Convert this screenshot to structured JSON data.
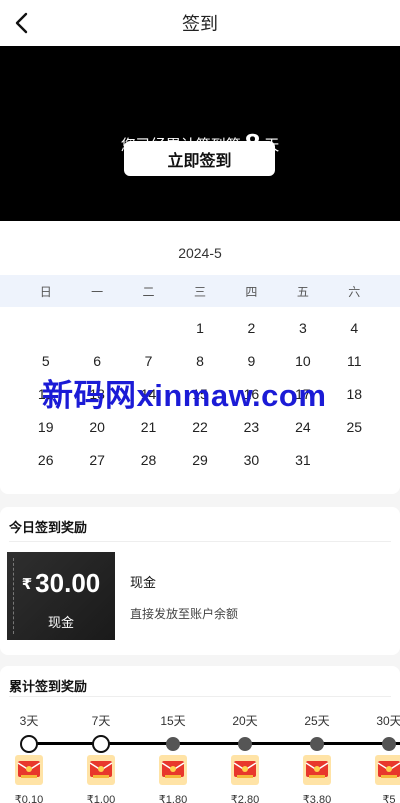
{
  "header": {
    "title": "签到"
  },
  "hero": {
    "prefix": "您已经累计签到第",
    "days": "8",
    "suffix": "天",
    "button_label": "立即签到"
  },
  "calendar": {
    "month": "2024-5",
    "weekdays": [
      "日",
      "一",
      "二",
      "三",
      "四",
      "五",
      "六"
    ],
    "leading_blanks": 3,
    "days": [
      "1",
      "2",
      "3",
      "4",
      "5",
      "6",
      "7",
      "8",
      "9",
      "10",
      "11",
      "12",
      "13",
      "14",
      "15",
      "16",
      "17",
      "18",
      "19",
      "20",
      "21",
      "22",
      "23",
      "24",
      "25",
      "26",
      "27",
      "28",
      "29",
      "30",
      "31"
    ]
  },
  "watermark": "新码网xinmaw.com",
  "today_reward": {
    "title": "今日签到奖励",
    "currency": "₹",
    "amount": "30.00",
    "unit": "现金",
    "name": "现金",
    "desc": "直接发放至账户余额"
  },
  "cumulative": {
    "title": "累计签到奖励",
    "milestones": [
      {
        "label": "3天",
        "status": "done",
        "amount": "₹0.10"
      },
      {
        "label": "7天",
        "status": "done",
        "amount": "₹1.00"
      },
      {
        "label": "15天",
        "status": "todo",
        "amount": "₹1.80"
      },
      {
        "label": "20天",
        "status": "todo",
        "amount": "₹2.80"
      },
      {
        "label": "25天",
        "status": "todo",
        "amount": "₹3.80"
      },
      {
        "label": "30天",
        "status": "todo",
        "amount": "₹5"
      }
    ]
  },
  "colors": {
    "hero_bg": "#000000",
    "weekday_bg": "#eef3fc",
    "watermark": "#1b1bd6",
    "gift_bg": "#ffe3a6",
    "gift_red": "#e8372c"
  }
}
